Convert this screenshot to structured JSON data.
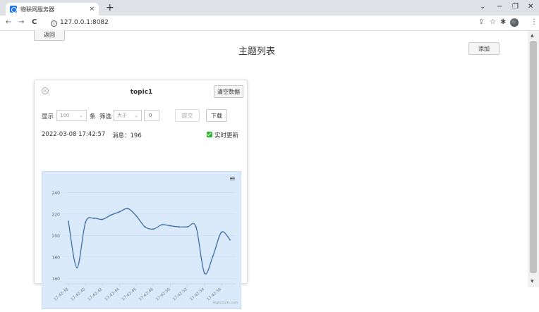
{
  "browser": {
    "tab_title": "物联网服务器",
    "tab_close": "×",
    "new_tab": "+",
    "minimize": "−",
    "maximize": "❐",
    "close": "✕",
    "back": "←",
    "forward": "→",
    "reload": "C",
    "url": "127.0.0.1:8082",
    "info": "i"
  },
  "page": {
    "back_label": "返回",
    "title": "主题列表",
    "add_label": "添加"
  },
  "card": {
    "close": "×",
    "title": "topic1",
    "clear_label": "清空数据",
    "show_label": "显示",
    "show_count": "100",
    "unit_label": "条",
    "filter_label": "筛选",
    "filter_op": "大于",
    "filter_value": "0",
    "submit_label": "提交",
    "download_label": "下载",
    "timestamp": "2022-03-08 17:42:57",
    "msg_label": "消息：196",
    "realtime_label": "实时更新"
  },
  "colors": {
    "plot_bg": "#dbeafb",
    "line": "#3d6ea5",
    "realtime": "#2eb82e"
  },
  "chart_data": {
    "type": "line",
    "credits": "Highcharts.com",
    "ylim": [
      155,
      252
    ],
    "yticks": [
      160,
      180,
      200,
      220,
      240
    ],
    "x": [
      "17:42:38",
      "",
      "17:42:40",
      "",
      "17:42:42",
      "",
      "17:42:44",
      "",
      "17:42:46",
      "",
      "17:42:48",
      "",
      "17:42:50",
      "",
      "17:42:52",
      "",
      "17:42:54",
      "",
      "17:42:56",
      ""
    ],
    "xtick_labels": [
      "17:42:38",
      "17:42:40",
      "17:42:42",
      "17:42:44",
      "17:42:46",
      "17:42:48",
      "17:42:50",
      "17:42:52",
      "17:42:54",
      "17:42:56"
    ],
    "series": [
      {
        "values": [
          213,
          170,
          212,
          216,
          215,
          219,
          222,
          225,
          218,
          208,
          206,
          210,
          209,
          208,
          208,
          208,
          165,
          181,
          203,
          196
        ]
      }
    ],
    "grid": true,
    "legend": "none"
  }
}
